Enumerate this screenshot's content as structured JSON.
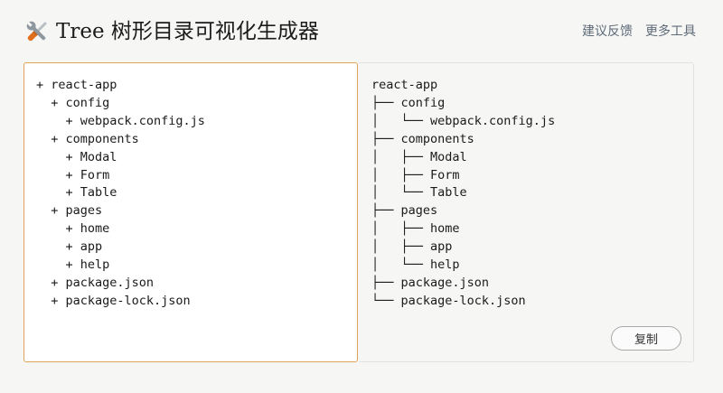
{
  "header": {
    "title": "Tree 树形目录可视化生成器",
    "logo_icon": "tools-icon",
    "nav": [
      {
        "label": "建议反馈"
      },
      {
        "label": "更多工具"
      }
    ]
  },
  "editor": {
    "value": "+ react-app\n  + config\n    + webpack.config.js\n  + components\n    + Modal\n    + Form\n    + Table\n  + pages\n    + home\n    + app\n    + help\n  + package.json\n  + package-lock.json"
  },
  "output": {
    "tree": "react-app\n├── config\n│   └── webpack.config.js\n├── components\n│   ├── Modal\n│   ├── Form\n│   └── Table\n├── pages\n│   ├── home\n│   ├── app\n│   └── help\n├── package.json\n└── package-lock.json",
    "copy_label": "复制"
  },
  "colors": {
    "editor_border": "#e0a458",
    "nav_link": "#5e6b78",
    "background": "#f6f6f5"
  }
}
